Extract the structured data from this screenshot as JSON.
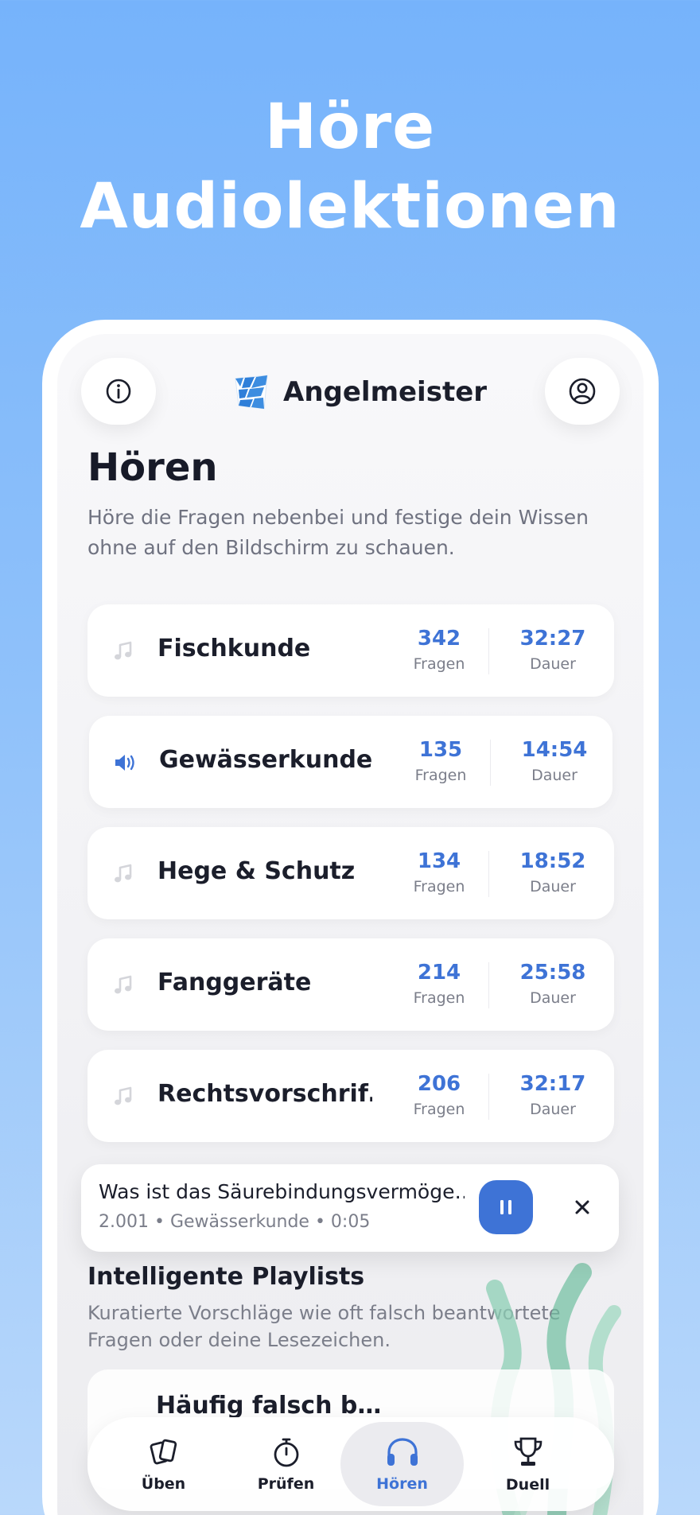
{
  "headline": {
    "line1": "Höre",
    "line2": "Audiolektionen"
  },
  "app": {
    "name": "Angelmeister"
  },
  "page": {
    "title": "Hören",
    "subtitle": "Höre die Fragen nebenbei und festige dein Wissen ohne auf den Bildschirm zu schauen."
  },
  "categories": [
    {
      "name": "Fischkunde",
      "questions": "342",
      "questions_label": "Fragen",
      "duration": "32:27",
      "duration_label": "Dauer",
      "icon": "music-note-icon",
      "active": false
    },
    {
      "name": "Gewässerkunde",
      "questions": "135",
      "questions_label": "Fragen",
      "duration": "14:54",
      "duration_label": "Dauer",
      "icon": "speaker-icon",
      "active": true
    },
    {
      "name": "Hege & Schutz",
      "questions": "134",
      "questions_label": "Fragen",
      "duration": "18:52",
      "duration_label": "Dauer",
      "icon": "music-note-icon",
      "active": false
    },
    {
      "name": "Fanggeräte",
      "questions": "214",
      "questions_label": "Fragen",
      "duration": "25:58",
      "duration_label": "Dauer",
      "icon": "music-note-icon",
      "active": false
    },
    {
      "name": "Rechtsvorschrif…",
      "questions": "206",
      "questions_label": "Fragen",
      "duration": "32:17",
      "duration_label": "Dauer",
      "icon": "music-note-icon",
      "active": false
    }
  ],
  "player": {
    "title": "Was ist das Säurebindungsvermöge…",
    "meta": "2.001 • Gewässerkunde • 0:05"
  },
  "playlists": {
    "title": "Intelligente Playlists",
    "subtitle": "Kuratierte Vorschläge wie oft falsch beantwortete Fragen oder deine Lesezeichen.",
    "items": [
      {
        "name": "Häufig falsch b…"
      }
    ]
  },
  "tabs": [
    {
      "label": "Üben",
      "icon": "cards-icon"
    },
    {
      "label": "Prüfen",
      "icon": "stopwatch-icon"
    },
    {
      "label": "Hören",
      "icon": "headphones-icon",
      "active": true
    },
    {
      "label": "Duell",
      "icon": "trophy-icon"
    }
  ],
  "colors": {
    "accent": "#3e73d6",
    "background": "#76b3fb",
    "text": "#1b1e2b",
    "muted": "#7b7e8a"
  }
}
